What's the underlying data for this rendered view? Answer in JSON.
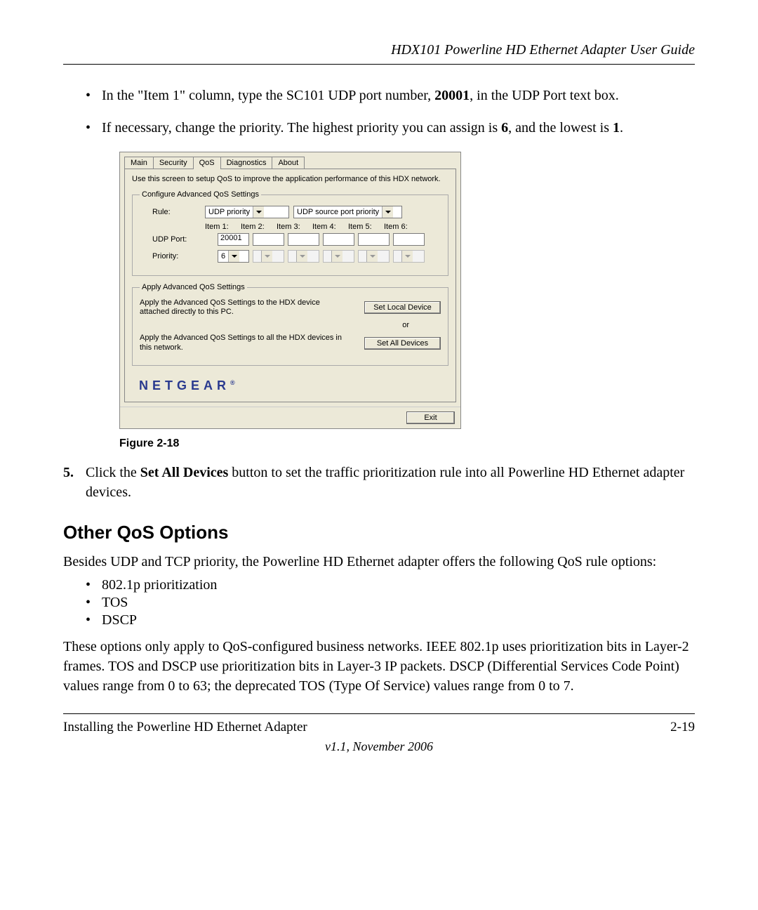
{
  "header": {
    "title": "HDX101 Powerline HD Ethernet Adapter User Guide"
  },
  "bullets": {
    "b1_pre": "In the \"Item 1\" column, type the SC101 UDP port number, ",
    "b1_bold": "20001",
    "b1_post": ", in the UDP Port text box.",
    "b2_pre": "If necessary, change the priority. The highest priority you can assign is ",
    "b2_bold1": "6",
    "b2_mid": ", and the lowest is ",
    "b2_bold2": "1",
    "b2_post": "."
  },
  "dialog": {
    "tabs": [
      "Main",
      "Security",
      "QoS",
      "Diagnostics",
      "About"
    ],
    "hint": "Use this screen to setup QoS to improve the application performance of this HDX network.",
    "fieldset1": {
      "legend": "Configure Advanced QoS Settings",
      "rule_label": "Rule:",
      "rule_combo1": "UDP priority",
      "rule_combo2": "UDP source port priority",
      "item_headers": [
        "Item 1:",
        "Item 2:",
        "Item 3:",
        "Item 4:",
        "Item 5:",
        "Item 6:"
      ],
      "udp_label": "UDP Port:",
      "udp_value": "20001",
      "priority_label": "Priority:",
      "priority_value": "6"
    },
    "fieldset2": {
      "legend": "Apply Advanced QoS Settings",
      "text1": "Apply the Advanced QoS Settings to the HDX device attached directly to this PC.",
      "btn1": "Set Local Device",
      "or": "or",
      "text2": "Apply the Advanced QoS Settings to all the HDX devices in this network.",
      "btn2": "Set All Devices"
    },
    "brand": "NETGEAR",
    "exit": "Exit"
  },
  "figure_caption": "Figure 2-18",
  "step5": {
    "num": "5.",
    "pre": "Click the ",
    "bold": "Set All Devices",
    "post": " button to set the traffic prioritization rule into all Powerline HD Ethernet adapter devices."
  },
  "section_heading": "Other QoS Options",
  "para1": "Besides UDP and TCP priority, the Powerline HD Ethernet adapter offers the following QoS rule options:",
  "sub_bullets": [
    "802.1p prioritization",
    "TOS",
    "DSCP"
  ],
  "para2": "These options only apply to QoS-configured business networks. IEEE 802.1p uses prioritization bits in Layer-2 frames. TOS and DSCP use prioritization bits in Layer-3 IP packets. DSCP (Differential Services Code Point) values range from 0 to 63; the deprecated TOS (Type Of Service) values range from 0 to 7.",
  "footer": {
    "left": "Installing the Powerline HD Ethernet Adapter",
    "right": "2-19",
    "version": "v1.1, November 2006"
  }
}
